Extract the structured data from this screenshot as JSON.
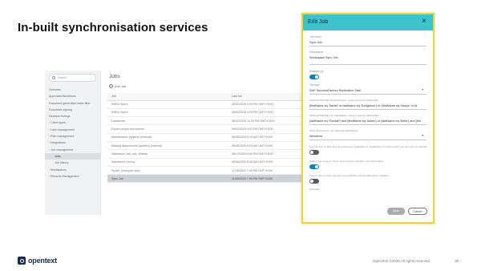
{
  "slide": {
    "title": "In-built synchronisation services",
    "copyright": "OpenText ©2025 All rights reserved",
    "page_number": "38",
    "logo_text": "opentext",
    "brand_color": "#1b2a4a"
  },
  "sidebar": {
    "search_placeholder": "Search",
    "items": [
      {
        "label": "Overview",
        "level": 0,
        "chevron": false,
        "active": false
      },
      {
        "label": "Approvals/Workflows",
        "level": 0,
        "chevron": false,
        "active": false
      },
      {
        "label": "Document generation tasks filter",
        "level": 0,
        "chevron": false,
        "active": false
      },
      {
        "label": "Document signing",
        "level": 0,
        "chevron": false,
        "active": false
      },
      {
        "label": "Declared listings",
        "level": 0,
        "chevron": false,
        "active": false
      },
      {
        "label": "Client types",
        "level": 0,
        "chevron": true,
        "active": false
      },
      {
        "label": "User management",
        "level": 0,
        "chevron": true,
        "active": false
      },
      {
        "label": "Plan management",
        "level": 0,
        "chevron": true,
        "active": false
      },
      {
        "label": "Integrations",
        "level": 0,
        "chevron": true,
        "active": false
      },
      {
        "label": "Job management",
        "level": 0,
        "chevron": true,
        "active": false
      },
      {
        "label": "Jobs",
        "level": 2,
        "chevron": false,
        "active": true
      },
      {
        "label": "Job history",
        "level": 2,
        "chevron": false,
        "active": false
      },
      {
        "label": "Workspaces",
        "level": 0,
        "chevron": true,
        "active": false
      },
      {
        "label": "Records Management",
        "level": 0,
        "chevron": true,
        "active": false
      }
    ]
  },
  "jobs": {
    "title": "Jobs",
    "add_label": "Add Job",
    "columns": [
      "Job",
      "Last run"
    ],
    "rows": [
      {
        "job": "EMEA Sync1",
        "last_run": "06/02/2025 3:05 PM GMT+0100",
        "selected": false
      },
      {
        "job": "EMEA Sync2",
        "last_run": "06/02/2025 3:09 PM GMT+0100",
        "selected": false
      },
      {
        "job": "Datacenter",
        "last_run": "06/02/2025 12:00 PM GMT+0100",
        "selected": false
      },
      {
        "job": "Export people documents",
        "last_run": "06/02/2025 4:03 PM GMT+0100",
        "selected": false
      },
      {
        "job": "Maintenance (system) (interval)",
        "last_run": "06/06/2025 8:15 AM GMT+0100",
        "selected": false
      },
      {
        "job": "Missing Attachments (system) (interval)",
        "last_run": "06/06/2025 8:09 AM GMT+0100",
        "selected": false
      },
      {
        "job": "Salesforce Job_cas_Weekly",
        "last_run": "06/17/2025 6:00 PM GMT+0100",
        "selected": false
      },
      {
        "job": "Salesforce_Hourly",
        "last_run": "06/06/2025 8:00 AM GMT+0100",
        "selected": false
      },
      {
        "job": "Sysdir_employee sync",
        "last_run": "11/05/2025 7:00 PM GMT+0100",
        "selected": false
      },
      {
        "job": "Sync Job",
        "last_run": "11/05/2025 7:00 PM GMT+0100",
        "selected": true
      }
    ]
  },
  "modal": {
    "title": "Edit Job",
    "accent_color": "#3cc4ca",
    "highlight_color": "#f2d331",
    "job_name_label": "Job name",
    "job_name": "Sync Job",
    "description_label": "Description",
    "description": "Workspace Sync Job",
    "enabled_label": "Enabled (a)",
    "enabled": true,
    "job_type_label": "Job type",
    "job_type": "SAP SuccessFactors Replication Task",
    "filter1_label": "Optional SAP filter for Employees. Leave empty for default filter",
    "filter1_value": "(firstName eq 'Daniel' or lastName eq 'Dodgeson') or (firstName eq 'Nanyo' or la",
    "filter2_label": "Optional SAP filter for Candidates. Leave empty for default filter",
    "filter2_value": "(lastName eq 'Sinclair') and (firstName eq 'Adam') or (lastName eq 'Betts') and (firs",
    "timeout_label": "Tools (timeframe) - for onboarding/attributes",
    "timeout_value": "Weekend",
    "option1_hint": "If set to 'true' to fully sync all employees regardless of modification (in submission) you can only be scheduled",
    "option1": false,
    "option2_hint": "Select 'true' to get to 'Sync' Jobs used to compare more information",
    "option2": true,
    "option3_hint": "If set to 'true' to 'true' the sync is to activate only for data will be modified",
    "option3": false,
    "schedule_label": "Schedule",
    "save_label": "Save",
    "cancel_label": "Cancel"
  }
}
